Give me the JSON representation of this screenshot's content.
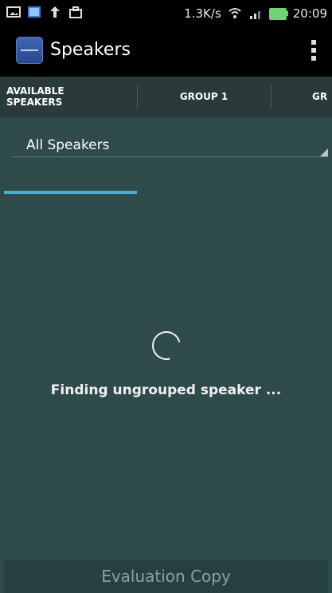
{
  "status_bar": {
    "speed": "1.3K/s",
    "time": "20:09",
    "icons": [
      "image-icon",
      "photo-icon",
      "upload-icon",
      "briefcase-icon",
      "wifi-icon",
      "signal-icon",
      "battery-icon"
    ]
  },
  "app": {
    "title": "Speakers",
    "menu_icon": "overflow-menu-icon"
  },
  "tabs": [
    {
      "label": "AVAILABLE SPEAKERS",
      "selected": true
    },
    {
      "label": "GROUP 1",
      "selected": false
    },
    {
      "label": "GR",
      "selected": false
    }
  ],
  "selector": {
    "value": "All Speakers"
  },
  "loading": {
    "text": "Finding ungrouped speaker ..."
  },
  "bottom": {
    "label": "Evaluation Copy"
  },
  "colors": {
    "accent": "#33b5e5",
    "background": "#2f4a4a",
    "bar": "#000000"
  }
}
